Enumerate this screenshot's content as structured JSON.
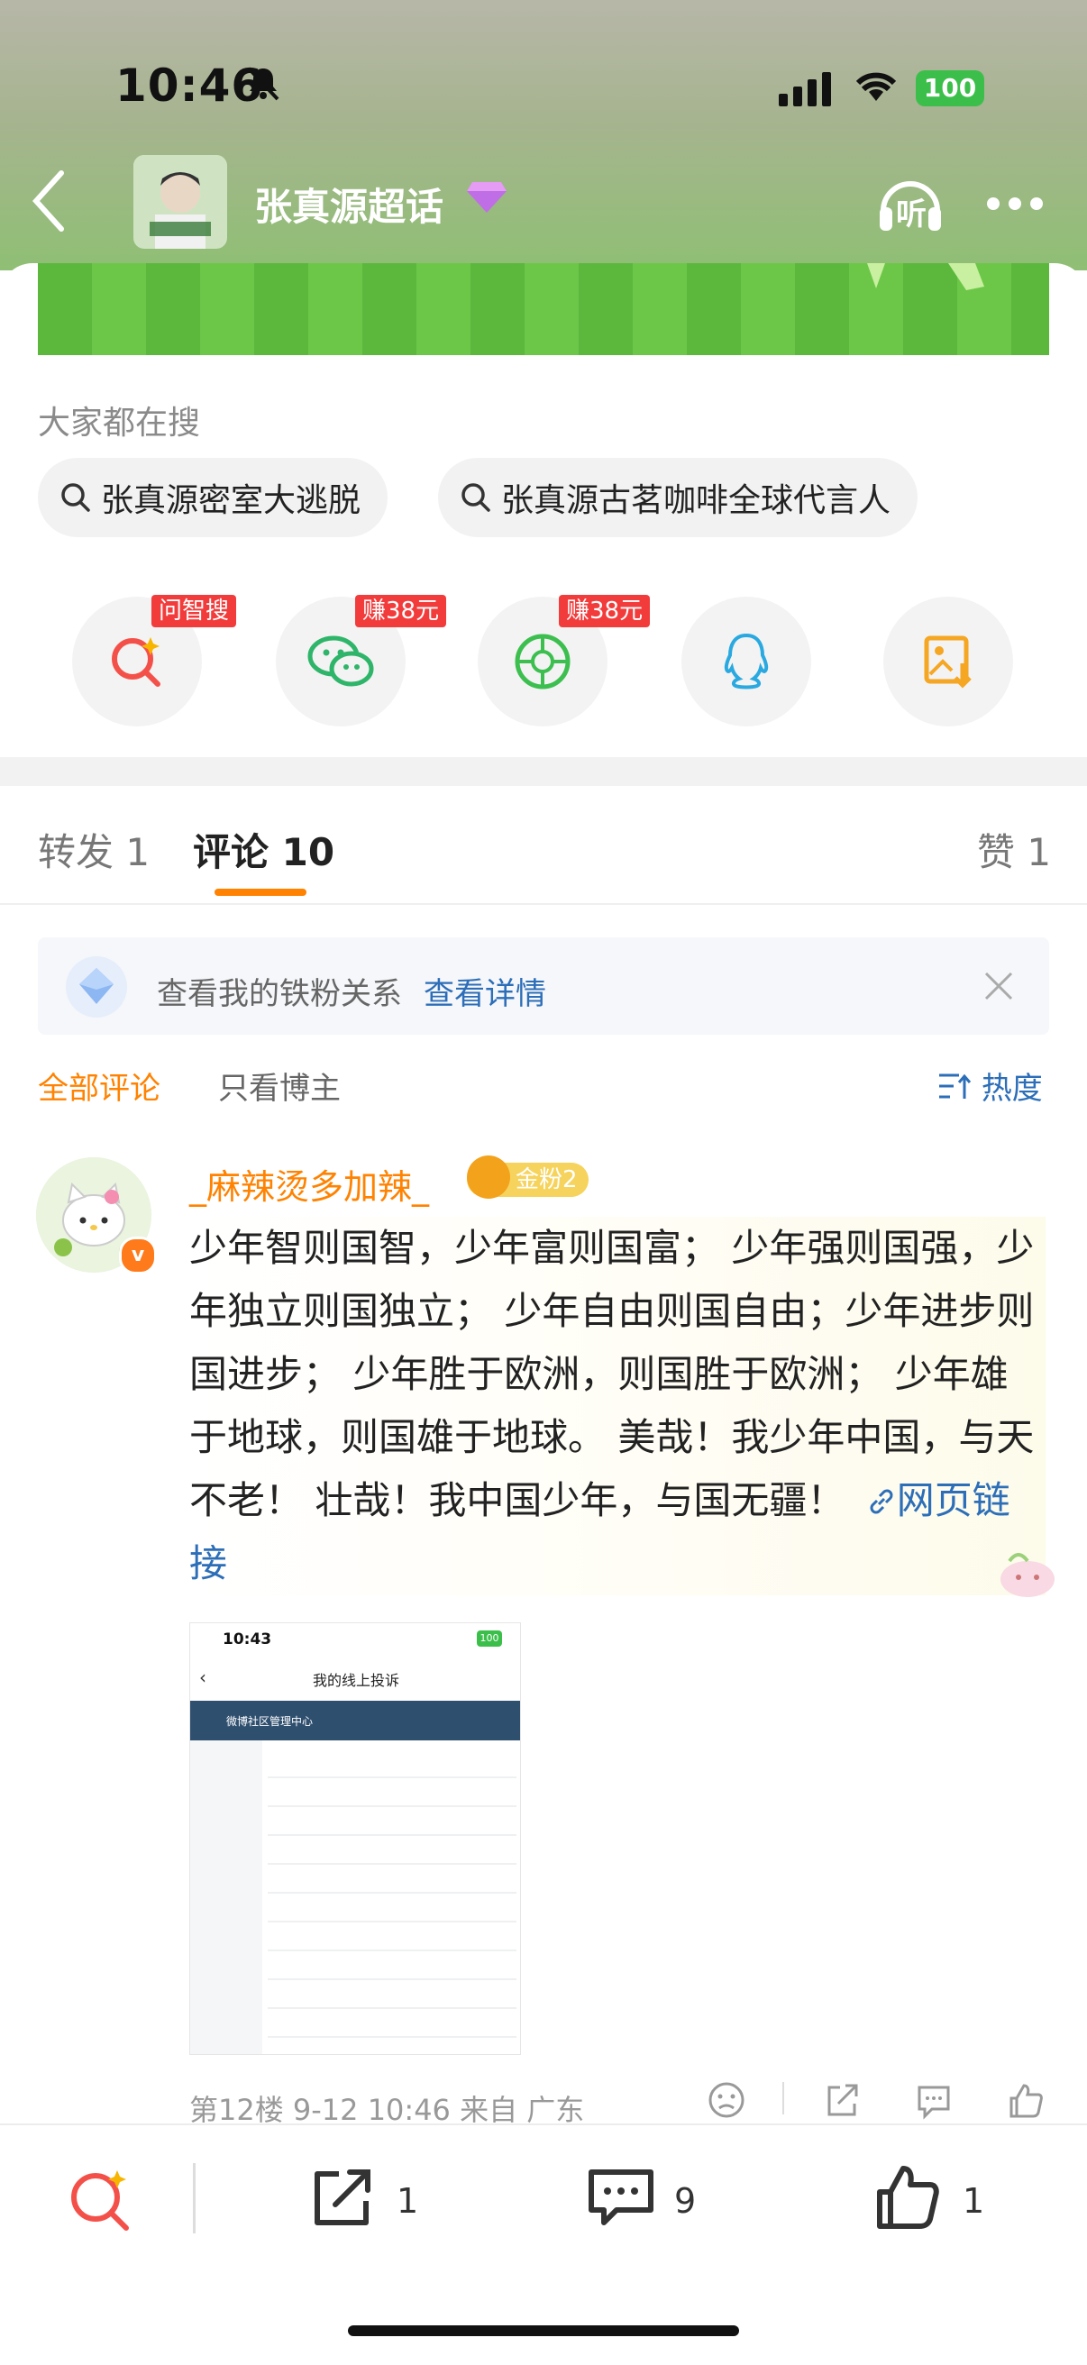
{
  "status": {
    "time": "10:46",
    "battery": "100"
  },
  "header": {
    "title": "张真源超话",
    "listen_icon": "headphones-icon",
    "listen_label": "听"
  },
  "search_hot": {
    "label": "大家都在搜",
    "chips": [
      "张真源密室大逃脱",
      "张真源古茗咖啡全球代言人"
    ]
  },
  "share": {
    "items": [
      {
        "icon": "wenzhisou-search-icon",
        "tag": "问智搜"
      },
      {
        "icon": "wechat-icon",
        "tag": "赚38元"
      },
      {
        "icon": "moments-icon",
        "tag": "赚38元"
      },
      {
        "icon": "qq-icon",
        "tag": ""
      },
      {
        "icon": "save-image-icon",
        "tag": ""
      }
    ]
  },
  "tabs": {
    "repost": "转发 1",
    "comments": "评论 10",
    "likes": "赞 1"
  },
  "fan_notice": {
    "text": "查看我的铁粉关系",
    "link": "查看详情"
  },
  "filters": {
    "all": "全部评论",
    "only_author": "只看博主",
    "sort": "热度"
  },
  "comment": {
    "username": "_麻辣烫多加辣_",
    "badge": "金粉2",
    "text": "少年智则国智，少年富则国富； 少年强则国强，少年独立则国独立； 少年自由则国自由；少年进步则国进步； 少年胜于欧洲，则国胜于欧洲； 少年雄于地球，则国雄于地球。 美哉！我少年中国，与天不老！ 壮哉！我中国少年，与国无疆！",
    "link_text": "网页链接",
    "meta": "第12楼 9-12 10:46 来自 广东",
    "screenshot": {
      "time": "10:43",
      "battery": "100",
      "title": "我的线上投诉",
      "site": "微博社区管理中心"
    }
  },
  "bottom_bar": {
    "repost_count": "1",
    "comment_count": "9",
    "like_count": "1"
  },
  "colors": {
    "accent": "#ff8200",
    "link": "#2c6eb8",
    "tag": "#f23c3c",
    "banner": "#5bb83d"
  }
}
